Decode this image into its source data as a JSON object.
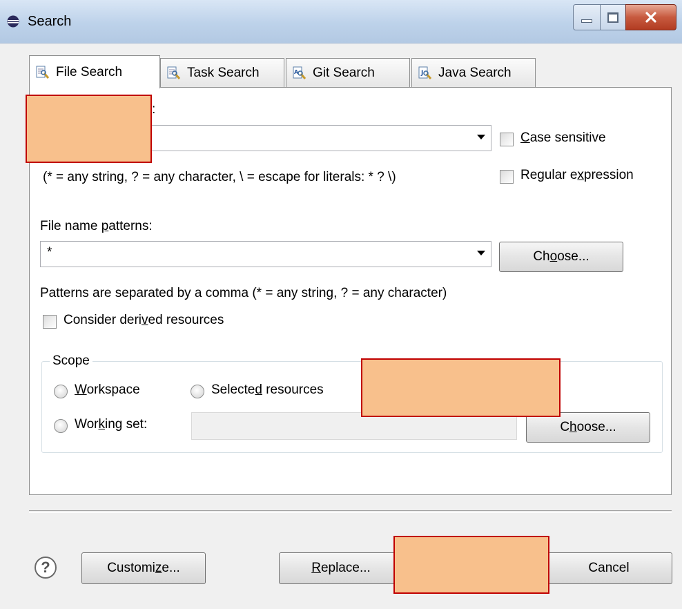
{
  "window": {
    "title": "Search",
    "icon": "eclipse-icon",
    "controls": [
      "minimize-icon",
      "maximize-icon",
      "close-icon"
    ]
  },
  "tabs": [
    {
      "label": "File Search",
      "icon": "file-search-icon",
      "active": true
    },
    {
      "label": "Task Search",
      "icon": "task-search-icon",
      "active": false
    },
    {
      "label": "Git Search",
      "icon": "git-search-icon",
      "active": false
    },
    {
      "label": "Java Search",
      "icon": "java-search-icon",
      "active": false
    }
  ],
  "containing_text": {
    "label_suffix": ":",
    "value": "",
    "hint": "(* = any string, ? = any character, \\ = escape for literals: * ? \\)",
    "case_sensitive": {
      "pre": "",
      "key": "C",
      "post": "ase sensitive",
      "checked": false
    },
    "regex": {
      "pre": "Regular e",
      "key": "x",
      "post": "pression",
      "checked": false
    }
  },
  "file_name_patterns": {
    "label_pre": "File name ",
    "label_key": "p",
    "label_post": "atterns:",
    "value": "*",
    "choose": {
      "pre": "Ch",
      "key": "o",
      "post": "ose..."
    },
    "hint": "Patterns are separated by a comma (* = any string, ? = any character)",
    "derived": {
      "pre": "Consider deri",
      "key": "v",
      "post": "ed resources",
      "checked": false
    }
  },
  "scope": {
    "title": "Scope",
    "workspace": {
      "pre": "",
      "key": "W",
      "post": "orkspace"
    },
    "selected": {
      "pre": "Selecte",
      "key": "d",
      "post": " resources"
    },
    "working_set": {
      "pre": "Wor",
      "key": "k",
      "post": "ing set:"
    },
    "working_set_value": "",
    "choose": {
      "pre": "C",
      "key": "h",
      "post": "oose..."
    }
  },
  "footer": {
    "customize": {
      "pre": "Customi",
      "key": "z",
      "post": "e..."
    },
    "replace": {
      "pre": "",
      "key": "R",
      "post": "eplace..."
    },
    "cancel": "Cancel"
  },
  "colors": {
    "redaction_fill": "#f8c08c",
    "redaction_border": "#c00000"
  }
}
